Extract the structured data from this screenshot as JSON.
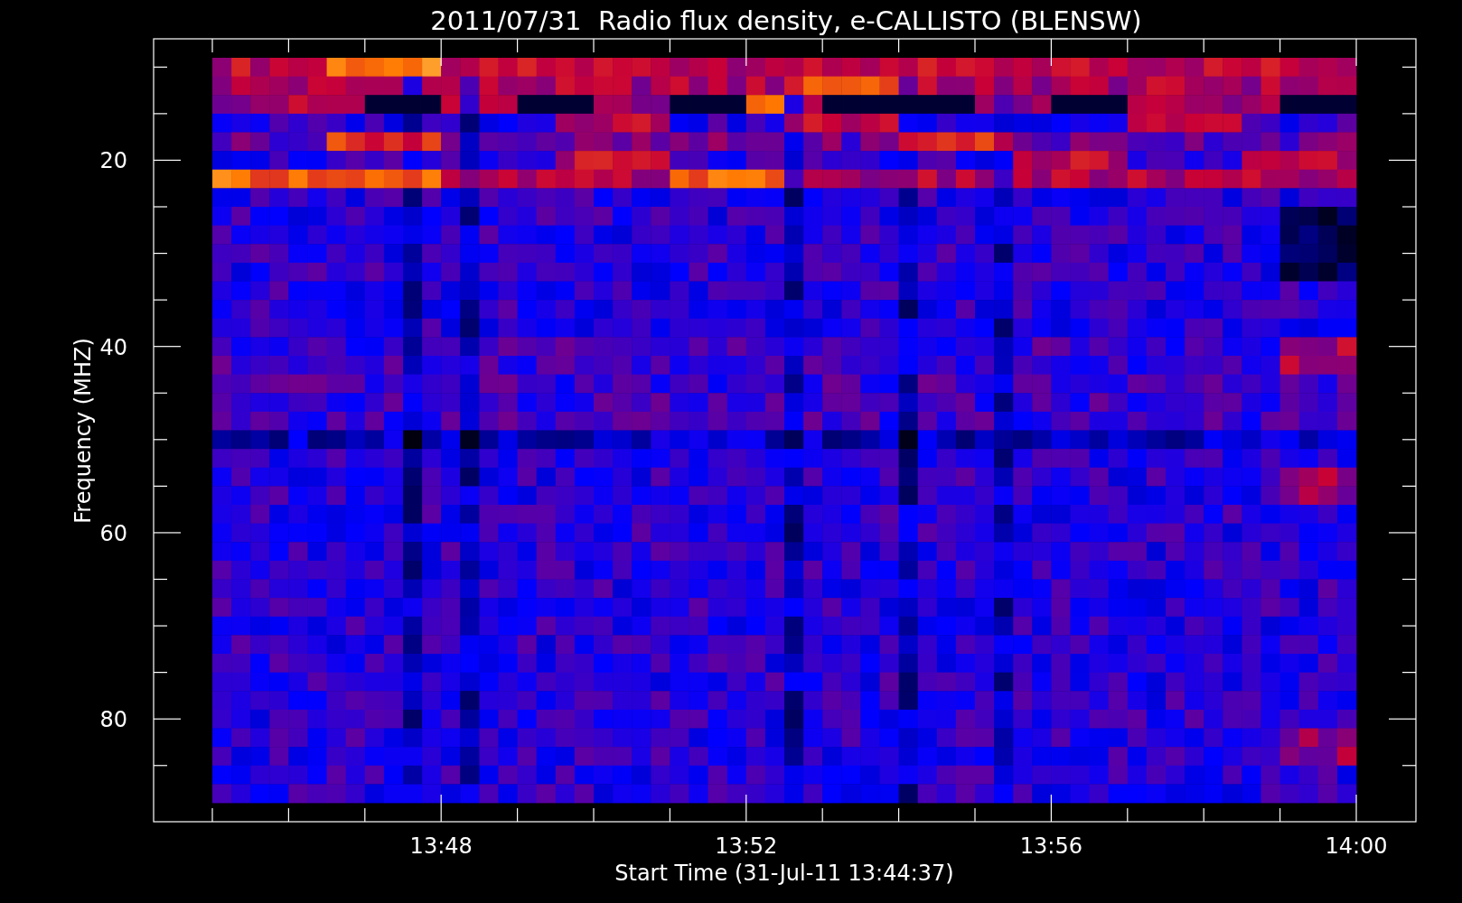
{
  "title": "2011/07/31  Radio flux density, e-CALLISTO (BLENSW)",
  "y_axis": {
    "label": "Frequency (MHZ)",
    "ticks": [
      "20",
      "40",
      "60",
      "80"
    ]
  },
  "x_axis": {
    "label": "Start Time (31-Jul-11 13:44:37)",
    "ticks": [
      "13:48",
      "13:52",
      "13:56",
      "14:00"
    ]
  }
}
